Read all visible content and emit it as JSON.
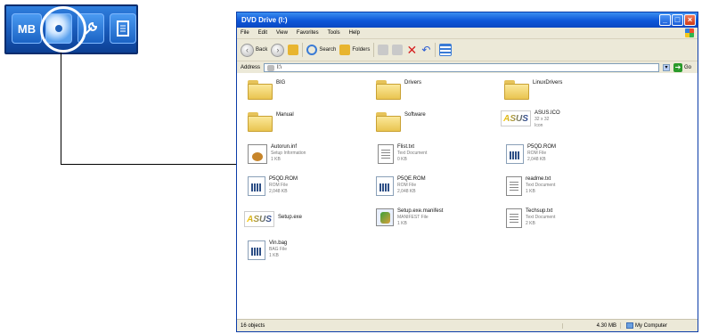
{
  "toolstrip": {
    "mb_label": "MB"
  },
  "window": {
    "title": "DVD Drive (I:)",
    "menu": [
      "File",
      "Edit",
      "View",
      "Favorites",
      "Tools",
      "Help"
    ],
    "toolbar": {
      "back_label": "Back",
      "search_label": "Search",
      "folders_label": "Folders"
    },
    "address": {
      "label": "Address",
      "value": "I:\\",
      "go_label": "Go"
    },
    "items": [
      {
        "name": "BIG",
        "type": "folder"
      },
      {
        "name": "Drivers",
        "type": "folder"
      },
      {
        "name": "LinuxDrivers",
        "type": "folder"
      },
      {
        "name": "Manual",
        "type": "folder"
      },
      {
        "name": "Software",
        "type": "folder"
      },
      {
        "name": "ASUS.ICO",
        "sub1": "32 x 32",
        "sub2": "Icon",
        "type": "asus"
      },
      {
        "name": "Autorun.inf",
        "sub1": "Setup Information",
        "sub2": "1 KB",
        "type": "setupinf"
      },
      {
        "name": "Flist.txt",
        "sub1": "Text Document",
        "sub2": "0 KB",
        "type": "doc"
      },
      {
        "name": "P5QD.ROM",
        "sub1": "ROM File",
        "sub2": "2,048 KB",
        "type": "rom"
      },
      {
        "name": "P5QD.ROM",
        "sub1": "ROM File",
        "sub2": "2,048 KB",
        "type": "rom"
      },
      {
        "name": "P5QE.ROM",
        "sub1": "ROM File",
        "sub2": "2,048 KB",
        "type": "rom"
      },
      {
        "name": "readme.txt",
        "sub1": "Text Document",
        "sub2": "1 KB",
        "type": "doc"
      },
      {
        "name": "Setup.exe",
        "type": "asus"
      },
      {
        "name": "Setup.exe.manifest",
        "sub1": "MANIFEST File",
        "sub2": "1 KB",
        "type": "manifest"
      },
      {
        "name": "Techsup.txt",
        "sub1": "Text Document",
        "sub2": "2 KB",
        "type": "doc"
      },
      {
        "name": "Vin.bag",
        "sub1": "BAG File",
        "sub2": "1 KB",
        "type": "rom"
      }
    ],
    "status": {
      "objects": "16 objects",
      "size": "4.30 MB",
      "location": "My Computer"
    }
  }
}
